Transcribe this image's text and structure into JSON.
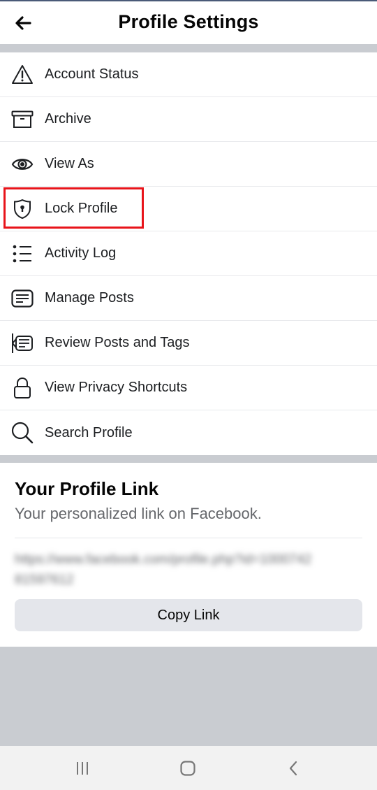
{
  "header": {
    "title": "Profile Settings",
    "back_icon": "arrow-left-icon"
  },
  "menu": {
    "items": [
      {
        "label": "Account Status",
        "icon": "warning-triangle-icon"
      },
      {
        "label": "Archive",
        "icon": "archive-box-icon"
      },
      {
        "label": "View As",
        "icon": "eye-icon"
      },
      {
        "label": "Lock Profile",
        "icon": "shield-lock-icon",
        "highlighted": true
      },
      {
        "label": "Activity Log",
        "icon": "list-icon"
      },
      {
        "label": "Manage Posts",
        "icon": "posts-icon"
      },
      {
        "label": "Review Posts and Tags",
        "icon": "review-tags-icon"
      },
      {
        "label": "View Privacy Shortcuts",
        "icon": "padlock-icon"
      },
      {
        "label": "Search Profile",
        "icon": "search-icon"
      }
    ]
  },
  "profile_link": {
    "title": "Your Profile Link",
    "subtitle": "Your personalized link on Facebook.",
    "url_blurred": "https://www.facebook.com/profile.php?id=100074281597612",
    "copy_button": "Copy Link"
  },
  "navbar": {
    "recents_icon": "recent-apps-icon",
    "home_icon": "home-icon",
    "back_icon": "back-chevron-icon"
  },
  "colors": {
    "highlight": "#e8141a",
    "band": "#c9ccd1",
    "button_bg": "#e4e6eb",
    "secondary_text": "#65676b"
  }
}
